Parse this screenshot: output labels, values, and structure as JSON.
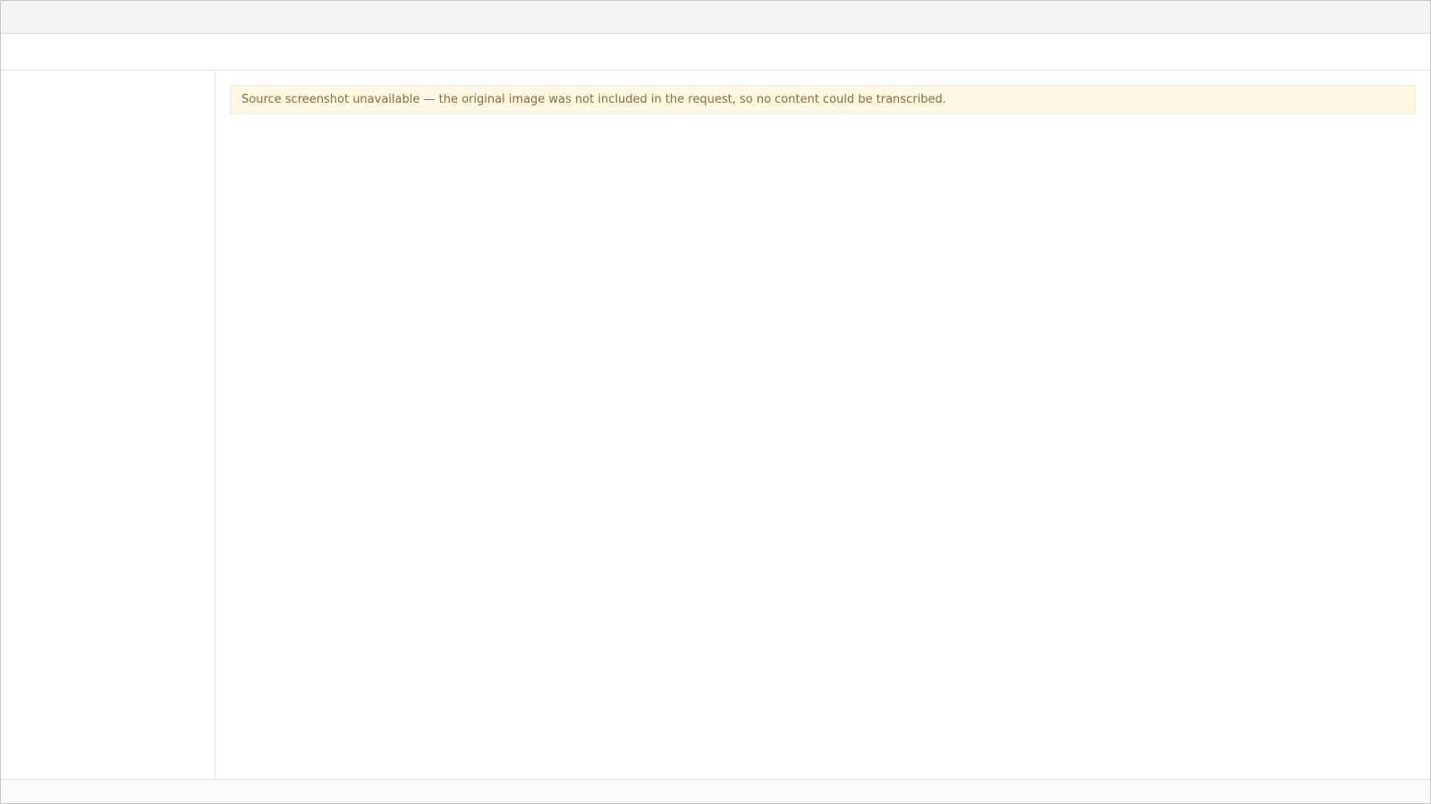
{
  "notice": "Source screenshot unavailable — the original image was not included in the request, so no content could be transcribed.",
  "window": {
    "title": ""
  },
  "toolbar": {
    "items": []
  },
  "sidebar": {
    "items": []
  },
  "main": {
    "heading": ""
  },
  "status": {
    "text": ""
  }
}
